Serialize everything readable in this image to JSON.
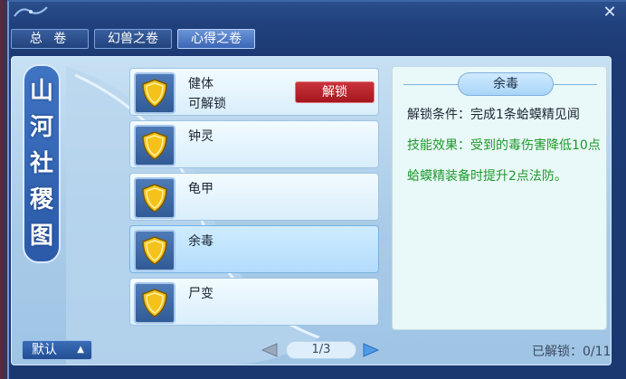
{
  "tabs": [
    {
      "label": "总 卷"
    },
    {
      "label": "幻兽之卷"
    },
    {
      "label": "心得之卷"
    }
  ],
  "close": {
    "label": "✕"
  },
  "banner": {
    "chars": [
      "山",
      "河",
      "社",
      "稷",
      "图"
    ]
  },
  "items": [
    {
      "name": "健体",
      "status": "可解锁",
      "action": "解锁"
    },
    {
      "name": "钟灵"
    },
    {
      "name": "龟甲"
    },
    {
      "name": "余毒"
    },
    {
      "name": "尸变"
    }
  ],
  "detail": {
    "title": "余毒",
    "condition": "解锁条件：完成1条蛤蟆精见闻",
    "effect_line1": "技能效果：受到的毒伤害降低10点",
    "effect_line2": "蛤蟆精装备时提升2点法防。"
  },
  "footer": {
    "default_label": "默认",
    "default_caret": "▲",
    "page": "1/3",
    "unlocked": "已解锁：0/11"
  },
  "colors": {
    "accent_red": "#a5161f",
    "effect_green": "#1d9a2a",
    "shield_gold": "#f4c21a"
  },
  "icons": {
    "item_icon": "shield-icon",
    "pager_left": "left-arrow-icon",
    "pager_right": "right-arrow-icon"
  }
}
